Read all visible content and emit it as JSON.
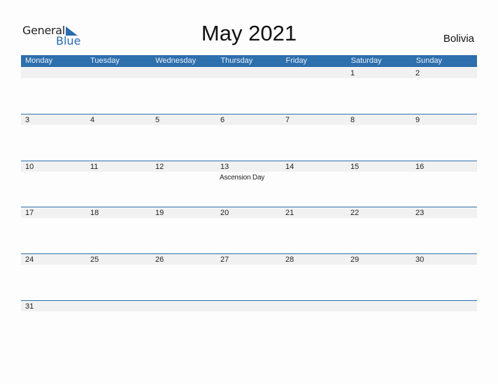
{
  "logo": {
    "word1": "General",
    "word2": "Blue",
    "icon": "triangle-flag-icon",
    "accent": "#2b6cb0"
  },
  "title": "May 2021",
  "country": "Bolivia",
  "colors": {
    "header_bg": "#2e6fad",
    "strip_bg": "#f1f1f1"
  },
  "weekdays": [
    "Monday",
    "Tuesday",
    "Wednesday",
    "Thursday",
    "Friday",
    "Saturday",
    "Sunday"
  ],
  "weeks": [
    {
      "days": [
        "",
        "",
        "",
        "",
        "",
        "1",
        "2"
      ],
      "holidays": [
        "",
        "",
        "",
        "",
        "",
        "",
        ""
      ]
    },
    {
      "days": [
        "3",
        "4",
        "5",
        "6",
        "7",
        "8",
        "9"
      ],
      "holidays": [
        "",
        "",
        "",
        "",
        "",
        "",
        ""
      ]
    },
    {
      "days": [
        "10",
        "11",
        "12",
        "13",
        "14",
        "15",
        "16"
      ],
      "holidays": [
        "",
        "",
        "",
        "Ascension Day",
        "",
        "",
        ""
      ]
    },
    {
      "days": [
        "17",
        "18",
        "19",
        "20",
        "21",
        "22",
        "23"
      ],
      "holidays": [
        "",
        "",
        "",
        "",
        "",
        "",
        ""
      ]
    },
    {
      "days": [
        "24",
        "25",
        "26",
        "27",
        "28",
        "29",
        "30"
      ],
      "holidays": [
        "",
        "",
        "",
        "",
        "",
        "",
        ""
      ]
    },
    {
      "days": [
        "31",
        "",
        "",
        "",
        "",
        "",
        ""
      ],
      "holidays": [
        "",
        "",
        "",
        "",
        "",
        "",
        ""
      ]
    }
  ]
}
